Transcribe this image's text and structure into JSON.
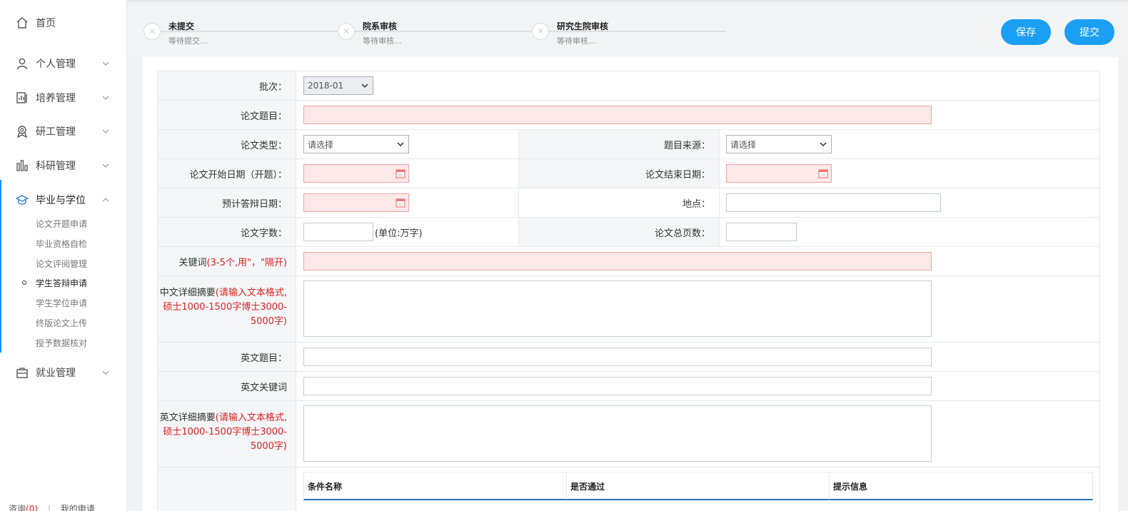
{
  "sidebar": {
    "home": "首页",
    "items": [
      {
        "label": "个人管理",
        "icon": "user-icon"
      },
      {
        "label": "培养管理",
        "icon": "book-chart-icon"
      },
      {
        "label": "研工管理",
        "icon": "badge-icon"
      },
      {
        "label": "科研管理",
        "icon": "bar-chart-icon"
      },
      {
        "label": "毕业与学位",
        "icon": "graduation-cap-icon"
      },
      {
        "label": "就业管理",
        "icon": "briefcase-icon"
      }
    ],
    "sub_items": [
      "论文开题申请",
      "毕业资格自检",
      "论文评阅管理",
      "学生答辩申请",
      "学生学位申请",
      "终版论文上传",
      "授予数据核对"
    ],
    "bottom_left": "咨询",
    "bottom_badge": "(0)",
    "bottom_right": "我的申请"
  },
  "steps": [
    {
      "title": "未提交",
      "sub": "等待提交..."
    },
    {
      "title": "院系审核",
      "sub": "等待审核..."
    },
    {
      "title": "研究生院审核",
      "sub": "等待审核..."
    }
  ],
  "buttons": {
    "save": "保存",
    "submit": "提交"
  },
  "form": {
    "batch_label": "批次：",
    "batch_value": "2018-01",
    "title_label": "论文题目：",
    "type_label": "论文类型：",
    "type_value": "请选择",
    "source_label": "题目来源：",
    "source_value": "请选择",
    "start_label": "论文开始日期（开题）：",
    "end_label": "论文结束日期：",
    "defense_label": "预计答辩日期：",
    "place_label": "地点：",
    "words_label": "论文字数：",
    "words_unit": "(单位:万字)",
    "pages_label": "论文总页数：",
    "kw_label": "关键词 ",
    "kw_hint": "(3-5个,用\"，\"隔开)",
    "cn_abs_label": "中文详细摘要",
    "cn_abs_hint": "(请输入文本格式,硕士1000-1500字博士3000-5000字)",
    "en_title_label": "英文题目：",
    "en_kw_label": "英文关键词",
    "en_abs_label": "英文详细摘要",
    "en_abs_hint": "(请输入文本格式,硕士1000-1500字博士3000-5000字)"
  },
  "cond_table": {
    "headers": [
      "条件名称",
      "是否通过",
      "提示信息"
    ]
  },
  "colors": {
    "accent": "#1a9ff5",
    "required_bg": "#fde9e9",
    "hint_red": "#e02020"
  }
}
